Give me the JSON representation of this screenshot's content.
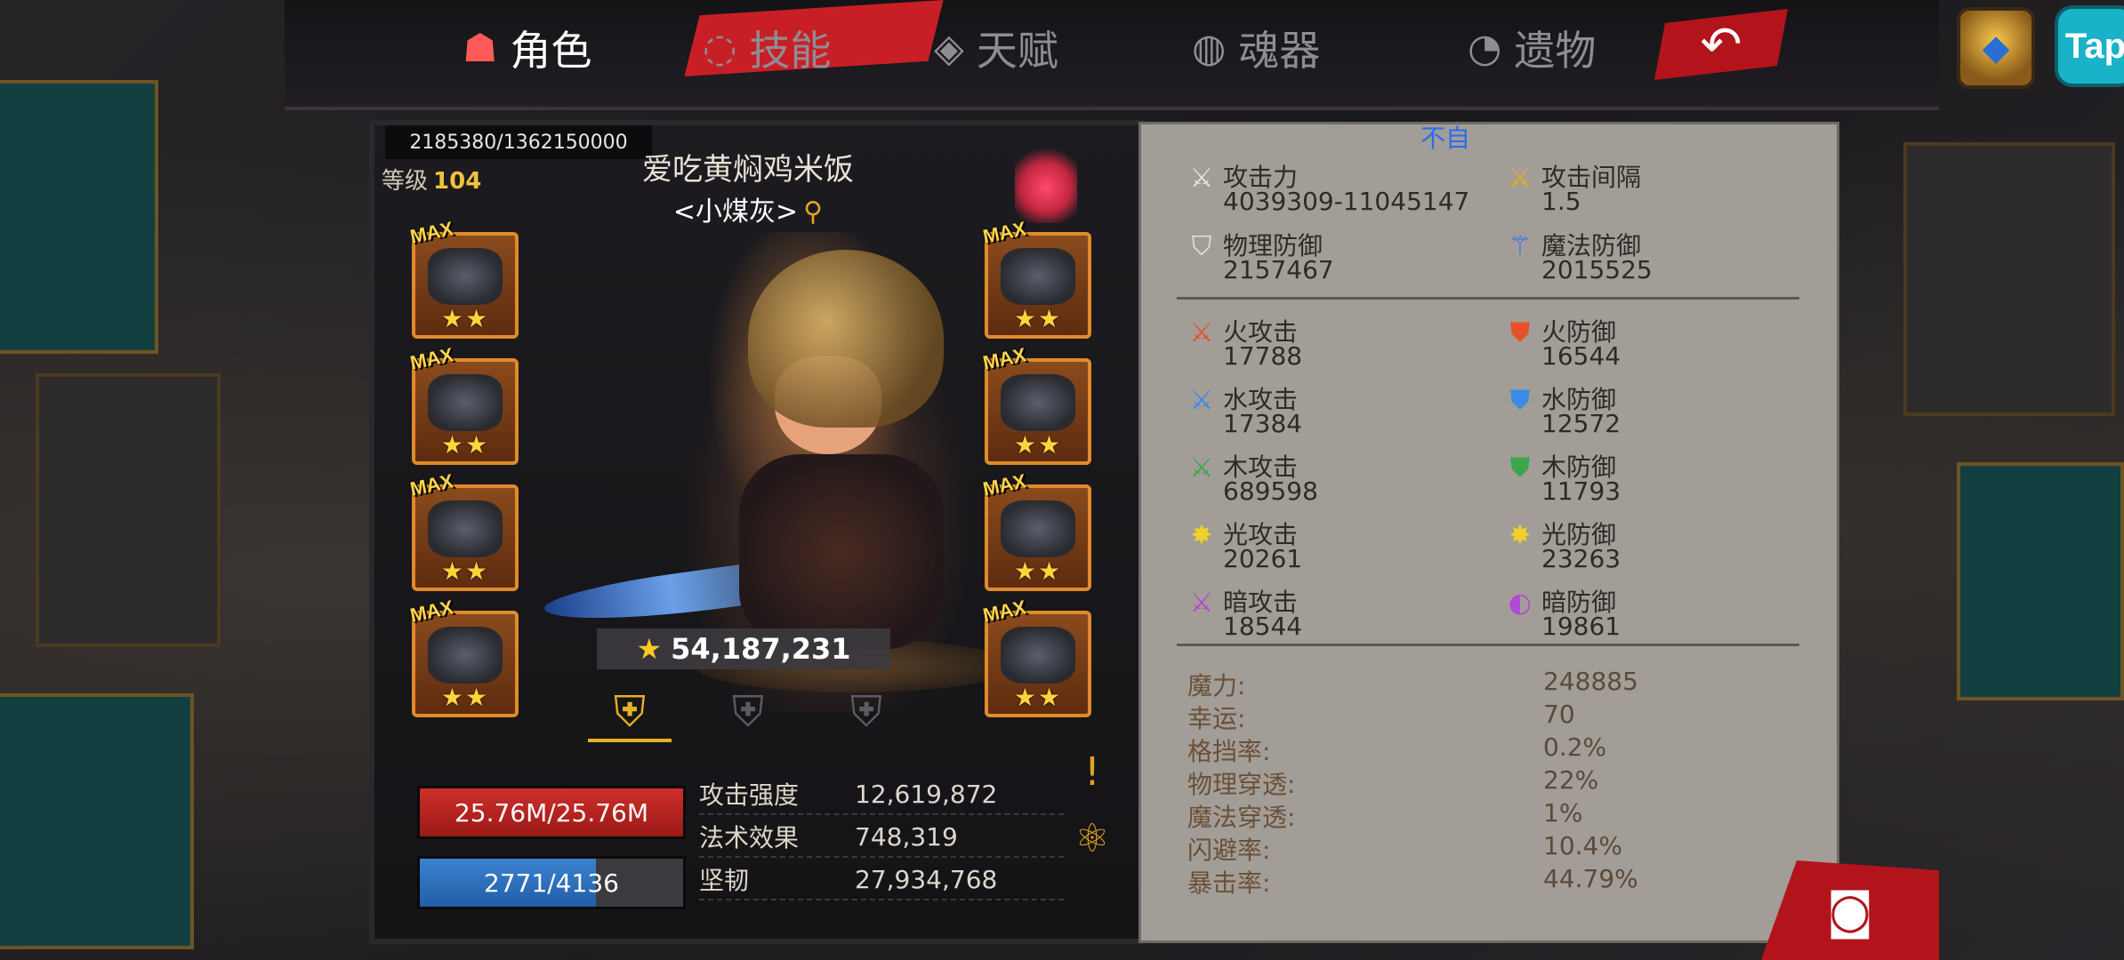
{
  "tabs": [
    {
      "label": "角色",
      "icon": "horned-skull-icon",
      "active": true
    },
    {
      "label": "技能",
      "icon": "swirl-icon",
      "active": false
    },
    {
      "label": "天赋",
      "icon": "wing-crest-icon",
      "active": false
    },
    {
      "label": "魂器",
      "icon": "soul-drop-icon",
      "active": false
    },
    {
      "label": "遗物",
      "icon": "relic-swirl-icon",
      "active": false
    }
  ],
  "top_right": {
    "tap_label": "Tap"
  },
  "character": {
    "exp": "2185380/1362150000",
    "level_label": "等级",
    "level": "104",
    "name": "爱吃黄焖鸡米饭",
    "guild": "<小煤灰>",
    "power": "54,187,231",
    "hp": "25.76M/25.76M",
    "mp": "2771/4136",
    "mp_fraction": 0.67,
    "equipment_left": [
      {
        "max": "MAX",
        "stars": "★★"
      },
      {
        "max": "MAX",
        "stars": "★★"
      },
      {
        "max": "MAX",
        "stars": "★★"
      },
      {
        "max": "MAX",
        "stars": "★★"
      }
    ],
    "equipment_right": [
      {
        "max": "MAX",
        "stars": "★★"
      },
      {
        "max": "MAX",
        "stars": "★★"
      },
      {
        "max": "MAX",
        "stars": "★★"
      },
      {
        "max": "MAX",
        "stars": "★★"
      }
    ],
    "attributes": [
      {
        "label": "攻击强度",
        "value": "12,619,872"
      },
      {
        "label": "法术效果",
        "value": "748,319"
      },
      {
        "label": "坚韧",
        "value": "27,934,768"
      }
    ]
  },
  "stats": {
    "hint": "不自",
    "primary": [
      {
        "label": "攻击力",
        "value": "4039309-11045147",
        "icon": "sword-icon"
      },
      {
        "label": "攻击间隔",
        "value": "1.5",
        "icon": "golden-sword-icon"
      },
      {
        "label": "物理防御",
        "value": "2157467",
        "icon": "shield-sword-icon"
      },
      {
        "label": "魔法防御",
        "value": "2015525",
        "icon": "magic-staff-icon"
      }
    ],
    "elements": [
      {
        "label": "火攻击",
        "value": "17788",
        "icon": "fire-sword-icon",
        "color": "#e8502a"
      },
      {
        "label": "火防御",
        "value": "16544",
        "icon": "fire-shield-icon",
        "color": "#e8502a"
      },
      {
        "label": "水攻击",
        "value": "17384",
        "icon": "water-sword-icon",
        "color": "#3a8ae8"
      },
      {
        "label": "水防御",
        "value": "12572",
        "icon": "water-shield-icon",
        "color": "#3a8ae8"
      },
      {
        "label": "木攻击",
        "value": "689598",
        "icon": "wood-sword-icon",
        "color": "#3aa84a"
      },
      {
        "label": "木防御",
        "value": "11793",
        "icon": "wood-shield-icon",
        "color": "#3aa84a"
      },
      {
        "label": "光攻击",
        "value": "20261",
        "icon": "light-sword-icon",
        "color": "#f0d02a"
      },
      {
        "label": "光防御",
        "value": "23263",
        "icon": "light-shield-icon",
        "color": "#f0d02a"
      },
      {
        "label": "暗攻击",
        "value": "18544",
        "icon": "dark-sword-icon",
        "color": "#b04ad0"
      },
      {
        "label": "暗防御",
        "value": "19861",
        "icon": "dark-shield-icon",
        "color": "#b04ad0"
      }
    ],
    "misc": [
      {
        "label": "魔力:",
        "value": "248885"
      },
      {
        "label": "幸运:",
        "value": "70"
      },
      {
        "label": "格挡率:",
        "value": "0.2%"
      },
      {
        "label": "物理穿透:",
        "value": "22%"
      },
      {
        "label": "魔法穿透:",
        "value": "1%"
      },
      {
        "label": "闪避率:",
        "value": "10.4%"
      },
      {
        "label": "暴击率:",
        "value": "44.79%"
      }
    ]
  }
}
